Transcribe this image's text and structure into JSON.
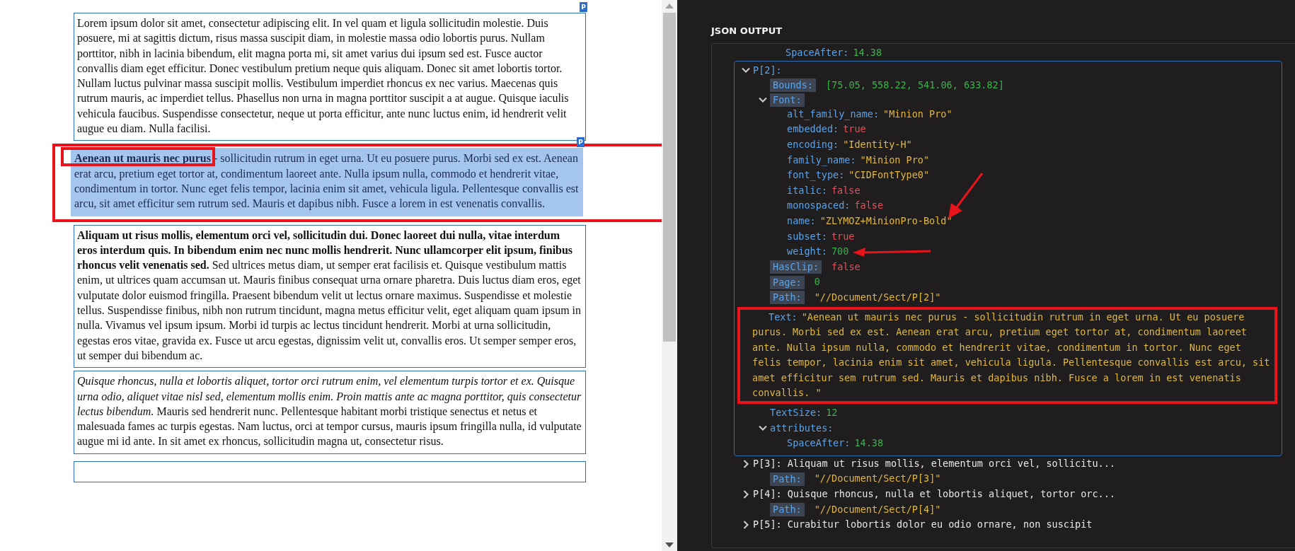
{
  "document": {
    "paragraphs": [
      {
        "tag": "P",
        "selected": false,
        "text": "Lorem ipsum dolor sit amet, consectetur adipiscing elit. In vel quam et ligula sollicitudin molestie. Duis posuere, mi at sagittis dictum, risus massa suscipit diam, in molestie massa odio lobortis purus. Nullam porttitor, nibh in lacinia bibendum, elit magna porta mi, sit amet varius dui ipsum sed est. Fusce auctor convallis diam eget efficitur. Donec vestibulum pretium neque quis aliquam. Donec sit amet lobortis tortor. Nullam luctus pulvinar massa suscipit mollis. Vestibulum imperdiet rhoncus ex nec varius. Maecenas quis rutrum mauris, ac imperdiet tellus. Phasellus non urna in magna porttitor suscipit a at augue. Quisque iaculis vehicula faucibus. Suspendisse consectetur, neque ut porta efficitur, ante nunc luctus enim, id hendrerit velit augue eu diam. Nulla facilisi."
      },
      {
        "tag": "P",
        "selected": true,
        "framed": true,
        "phrase_framed": true,
        "text": "**Aenean ut mauris nec purus** - sollicitudin rutrum in eget urna. Ut eu posuere purus. Morbi sed ex est. Aenean erat arcu, pretium eget tortor at, condimentum laoreet ante. Nulla ipsum nulla, commodo et hendrerit vitae, condimentum in tortor. Nunc eget felis tempor, lacinia enim sit amet, vehicula ligula. Pellentesque convallis est arcu, sit amet efficitur sem rutrum sed. Mauris et dapibus nibh. Fusce a lorem in est venenatis convallis."
      },
      {
        "selected": false,
        "text": "**Aliquam ut risus mollis, elementum orci vel, sollicitudin dui. Donec laoreet dui nulla, vitae interdum eros interdum quis. In bibendum enim nec nunc mollis hendrerit. Nunc ullamcorper elit ipsum, finibus rhoncus velit venenatis sed.** Sed ultrices metus diam, ut semper erat facilisis et. Quisque vestibulum mattis enim, ut ultrices quam accumsan ut. Mauris finibus consequat urna ornare pharetra. Duis luctus diam eros, eget vulputate dolor euismod fringilla. Praesent bibendum velit ut lectus ornare maximus. Suspendisse et molestie tellus. Suspendisse finibus, nibh non rutrum tincidunt, magna metus efficitur velit, eget aliquam quam ipsum in nulla. Vivamus vel ipsum ipsum. Morbi id turpis ac lectus tincidunt hendrerit. Morbi at urna sollicitudin, egestas eros vitae, gravida ex. Fusce ut arcu egestas, dignissim velit ut, convallis eros. Ut semper semper eros, ut semper dui bibendum ac."
      },
      {
        "selected": false,
        "text": "*Quisque rhoncus, nulla et lobortis aliquet, tortor orci rutrum enim, vel elementum turpis tortor et ex. Quisque urna odio, aliquet vitae nisl sed, elementum mollis enim. Proin mattis ante ac magna porttitor, quis consectetur lectus bibendum.* Mauris sed hendrerit nunc. Pellentesque habitant morbi tristique senectus et netus et malesuada fames ac turpis egestas. Nam luctus, orci at tempor cursus, mauris ipsum fringilla nulla, id vulputate augue mi id ante. In sit amet ex rhoncus, sollicitudin magna ut, consectetur risus."
      }
    ],
    "more_below": true
  },
  "json_panel": {
    "title": "JSON OUTPUT",
    "clipped_top": {
      "key": "SpaceAfter:",
      "kind": "number",
      "value": "14.38"
    },
    "nodes": [
      {
        "key": "P[2]:",
        "expanded": true,
        "selected": true,
        "children": [
          {
            "key": "Bounds:",
            "boxed": true,
            "kind": "array",
            "value": "[75.05, 558.22, 541.06, 633.82]"
          },
          {
            "key": "Font:",
            "boxed": true,
            "expanded": true,
            "children": [
              {
                "key": "alt_family_name:",
                "kind": "string",
                "value": "\"Minion Pro\""
              },
              {
                "key": "embedded:",
                "kind": "boolean",
                "value": "true"
              },
              {
                "key": "encoding:",
                "kind": "string",
                "value": "\"Identity-H\""
              },
              {
                "key": "family_name:",
                "kind": "string",
                "value": "\"Minion Pro\""
              },
              {
                "key": "font_type:",
                "kind": "string",
                "value": "\"CIDFontType0\""
              },
              {
                "key": "italic:",
                "kind": "boolean",
                "value": "false"
              },
              {
                "key": "monospaced:",
                "kind": "boolean",
                "value": "false"
              },
              {
                "key": "name:",
                "kind": "string",
                "value": "\"ZLYMOZ+MinionPro-Bold\"",
                "arrow": {
                  "kind": "diagonal"
                }
              },
              {
                "key": "subset:",
                "kind": "boolean",
                "value": "true"
              },
              {
                "key": "weight:",
                "kind": "number",
                "value": "700",
                "arrow": {
                  "kind": "horizontal"
                }
              }
            ]
          },
          {
            "key": "HasClip:",
            "boxed": true,
            "kind": "boolean",
            "value": "false"
          },
          {
            "key": "Page:",
            "boxed": true,
            "kind": "number",
            "value": "0"
          },
          {
            "key": "Path:",
            "boxed": true,
            "kind": "string",
            "value": "\"//Document/Sect/P[2]\""
          },
          {
            "key": "Text:",
            "kind": "string",
            "framed": true,
            "value": "\"Aenean ut mauris nec purus - sollicitudin rutrum in eget urna. Ut eu posuere purus. Morbi sed ex est. Aenean erat arcu, pretium eget tortor at, condimentum laoreet ante. Nulla ipsum nulla, commodo et hendrerit vitae, condimentum in tortor. Nunc eget felis tempor, lacinia enim sit amet, vehicula ligula. Pellentesque convallis est arcu, sit amet efficitur sem rutrum sed. Mauris et dapibus nibh. Fusce a lorem in est venenatis convallis. \""
          },
          {
            "key": "TextSize:",
            "kind": "number",
            "value": "12"
          },
          {
            "key": "attributes:",
            "expanded": true,
            "children": [
              {
                "key": "SpaceAfter:",
                "kind": "number",
                "value": "14.38"
              }
            ]
          }
        ]
      },
      {
        "key": "P[3]:",
        "expanded": false,
        "selected": false,
        "summary": "Aliquam ut risus mollis, elementum orci vel, sollicitu...",
        "path": {
          "key": "Path:",
          "boxed": true,
          "kind": "string",
          "value": "\"//Document/Sect/P[3]\""
        }
      },
      {
        "key": "P[4]:",
        "expanded": false,
        "selected": false,
        "summary": "Quisque rhoncus, nulla et lobortis aliquet, tortor orc...",
        "path": {
          "key": "Path:",
          "boxed": true,
          "kind": "string",
          "value": "\"//Document/Sect/P[4]\""
        }
      },
      {
        "key": "P[5]:",
        "expanded": false,
        "selected": false,
        "summary": "Curabitur lobortis dolor eu odio ornare, non suscipit"
      }
    ]
  }
}
